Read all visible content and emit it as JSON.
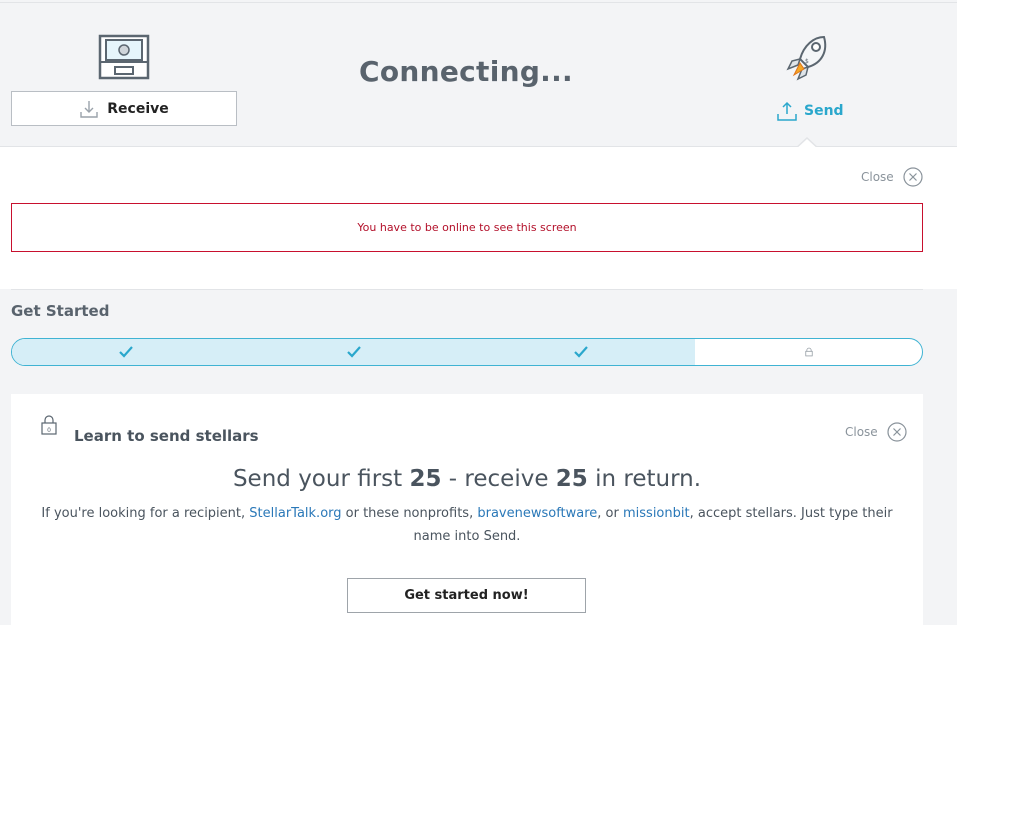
{
  "header": {
    "status_title": "Connecting...",
    "receive_label": "Receive",
    "send_label": "Send"
  },
  "send_panel": {
    "close_label": "Close",
    "error_message": "You have to be online to see this screen"
  },
  "get_started": {
    "title": "Get Started",
    "progress": {
      "completed_steps": 3,
      "total_steps": 4
    },
    "steps": [
      {
        "icon": "check-icon",
        "state": "done"
      },
      {
        "icon": "check-icon",
        "state": "done"
      },
      {
        "icon": "check-icon",
        "state": "done"
      },
      {
        "icon": "lock-icon",
        "state": "locked"
      }
    ]
  },
  "card": {
    "title": "Learn to send stellars",
    "close_label": "Close",
    "headline": {
      "pre": "Send your first ",
      "amount1": "25",
      "mid": " - receive ",
      "amount2": "25",
      "post": " in return."
    },
    "description": {
      "part1": "If you're looking for a recipient, ",
      "link1": "StellarTalk.org",
      "part2": " or these nonprofits, ",
      "link2": "bravenewsoftware",
      "part3": ", or ",
      "link3": "missionbit",
      "part4": ", accept stellars. Just type their name into Send."
    },
    "cta_label": "Get started now!"
  },
  "colors": {
    "accent": "#2aa7cc",
    "error": "#c8102e",
    "link": "#2a78b8",
    "progress_fill": "#d6eef7"
  }
}
